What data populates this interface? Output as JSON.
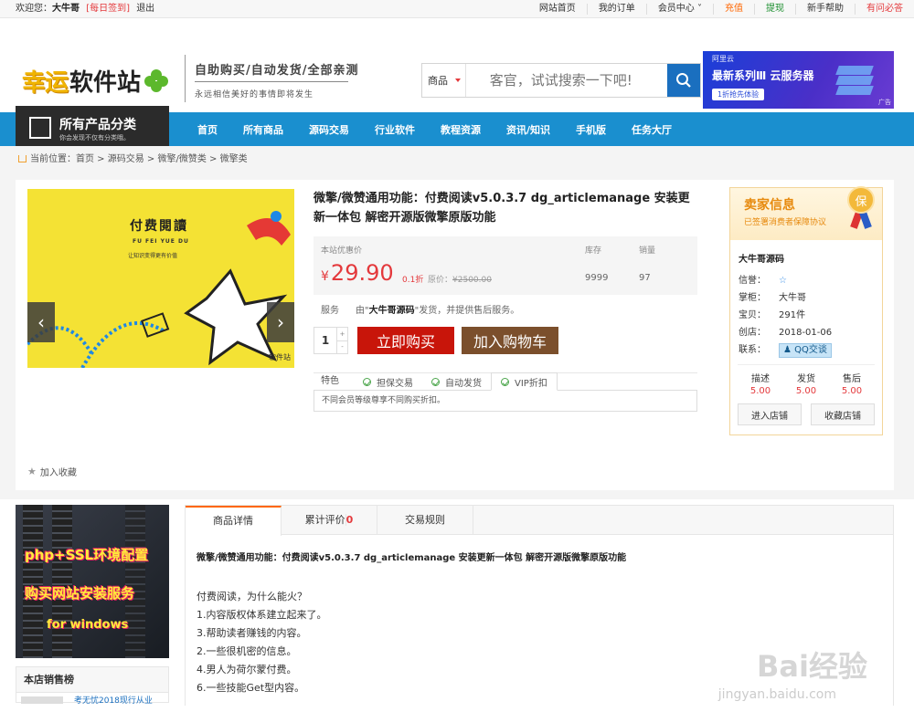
{
  "topbar": {
    "welcome": "欢迎您：",
    "user": "大牛哥",
    "checkin": "[每日签到]",
    "logout": "退出",
    "links": [
      "网站首页",
      "我的订单",
      "会员中心 ˅",
      "充值",
      "提现",
      "新手帮助",
      "有问必答"
    ]
  },
  "logo": {
    "part1": "幸运",
    "part2": "软件站"
  },
  "slogan": {
    "line1": "自助购买/自动发货/全部亲测",
    "line2": "永远相信美好的事情即将发生"
  },
  "search": {
    "category": "商品",
    "placeholder": "客官，试试搜索一下吧!"
  },
  "ad": {
    "brand": "阿里云",
    "title": "最新系列Ⅲ 云服务器",
    "promo": "1折抢先体验",
    "tag": "广告"
  },
  "nav": {
    "all_title": "所有产品分类",
    "all_sub": "你会发现不仅有分类哦。",
    "items": [
      "首页",
      "所有商品",
      "源码交易",
      "行业软件",
      "教程资源",
      "资讯/知识",
      "手机版",
      "任务大厅"
    ]
  },
  "breadcrumb": "当前位置：首页 > 源码交易 > 微擎/微赞类 > 微擎类",
  "gallery": {
    "title": "付费閱讀",
    "pinyin": "FU FEI YUE DU",
    "tagline": "让知识变得更有价值",
    "watermark": "软件站"
  },
  "product": {
    "title": "微擎/微赞通用功能：付费阅读v5.0.3.7 dg_articlemanage 安装更新一体包 解密开源版微擎原版功能",
    "price_label": "本站优惠价",
    "stock_label": "库存",
    "sales_label": "销量",
    "price_symbol": "¥",
    "price": "29.90",
    "discount": "0.1折",
    "orig_label": "原价：",
    "orig_price": "¥2500.00",
    "stock": "9999",
    "sales": "97",
    "service_label": "服务",
    "service_pre": "由\"",
    "service_shop": "大牛哥源码",
    "service_post": "\"发货，并提供售后服务。",
    "qty": "1",
    "buy_now": "立即购买",
    "add_cart": "加入购物车",
    "features_label": "特色",
    "features": [
      "担保交易",
      "自动发货",
      "VIP折扣"
    ],
    "feature_desc": "不同会员等级尊享不同购买折扣。",
    "favorite": "加入收藏"
  },
  "seller": {
    "title": "卖家信息",
    "subtitle": "已签署消费者保障协议",
    "badge": "保",
    "name": "大牛哥源码",
    "rows": [
      {
        "k": "信誉：",
        "v": "☆"
      },
      {
        "k": "掌柜：",
        "v": "大牛哥"
      },
      {
        "k": "宝贝：",
        "v": "291件"
      },
      {
        "k": "创店：",
        "v": "2018-01-06"
      }
    ],
    "contact_label": "联系：",
    "qq": "QQ交谈",
    "scores": [
      {
        "k": "描述",
        "v": "5.00"
      },
      {
        "k": "发货",
        "v": "5.00"
      },
      {
        "k": "售后",
        "v": "5.00"
      }
    ],
    "enter": "进入店铺",
    "collect": "收藏店铺"
  },
  "sidebar": {
    "banner1": "php+SSL环境配置",
    "banner2": "购买网站安装服务",
    "banner3": "for windows",
    "hot_title": "本店销售榜",
    "hot_item": "考无忧2018现行从业"
  },
  "detail": {
    "tabs": [
      "商品详情",
      "累计评价",
      "交易规则"
    ],
    "review_count": "0",
    "heading": "微擎/微赞通用功能：付费阅读v5.0.3.7 dg_articlemanage  安装更新一体包 解密开源版微擎原版功能",
    "lines": [
      "付费阅读，为什么能火？",
      "1.内容版权体系建立起来了。",
      "3.帮助读者赚钱的内容。",
      "2.一些很机密的信息。",
      "4.男人为荷尔蒙付费。",
      "6.一些技能Get型内容。"
    ]
  },
  "watermark": {
    "big": "Bai经验",
    "small": "jingyan.baidu.com"
  }
}
